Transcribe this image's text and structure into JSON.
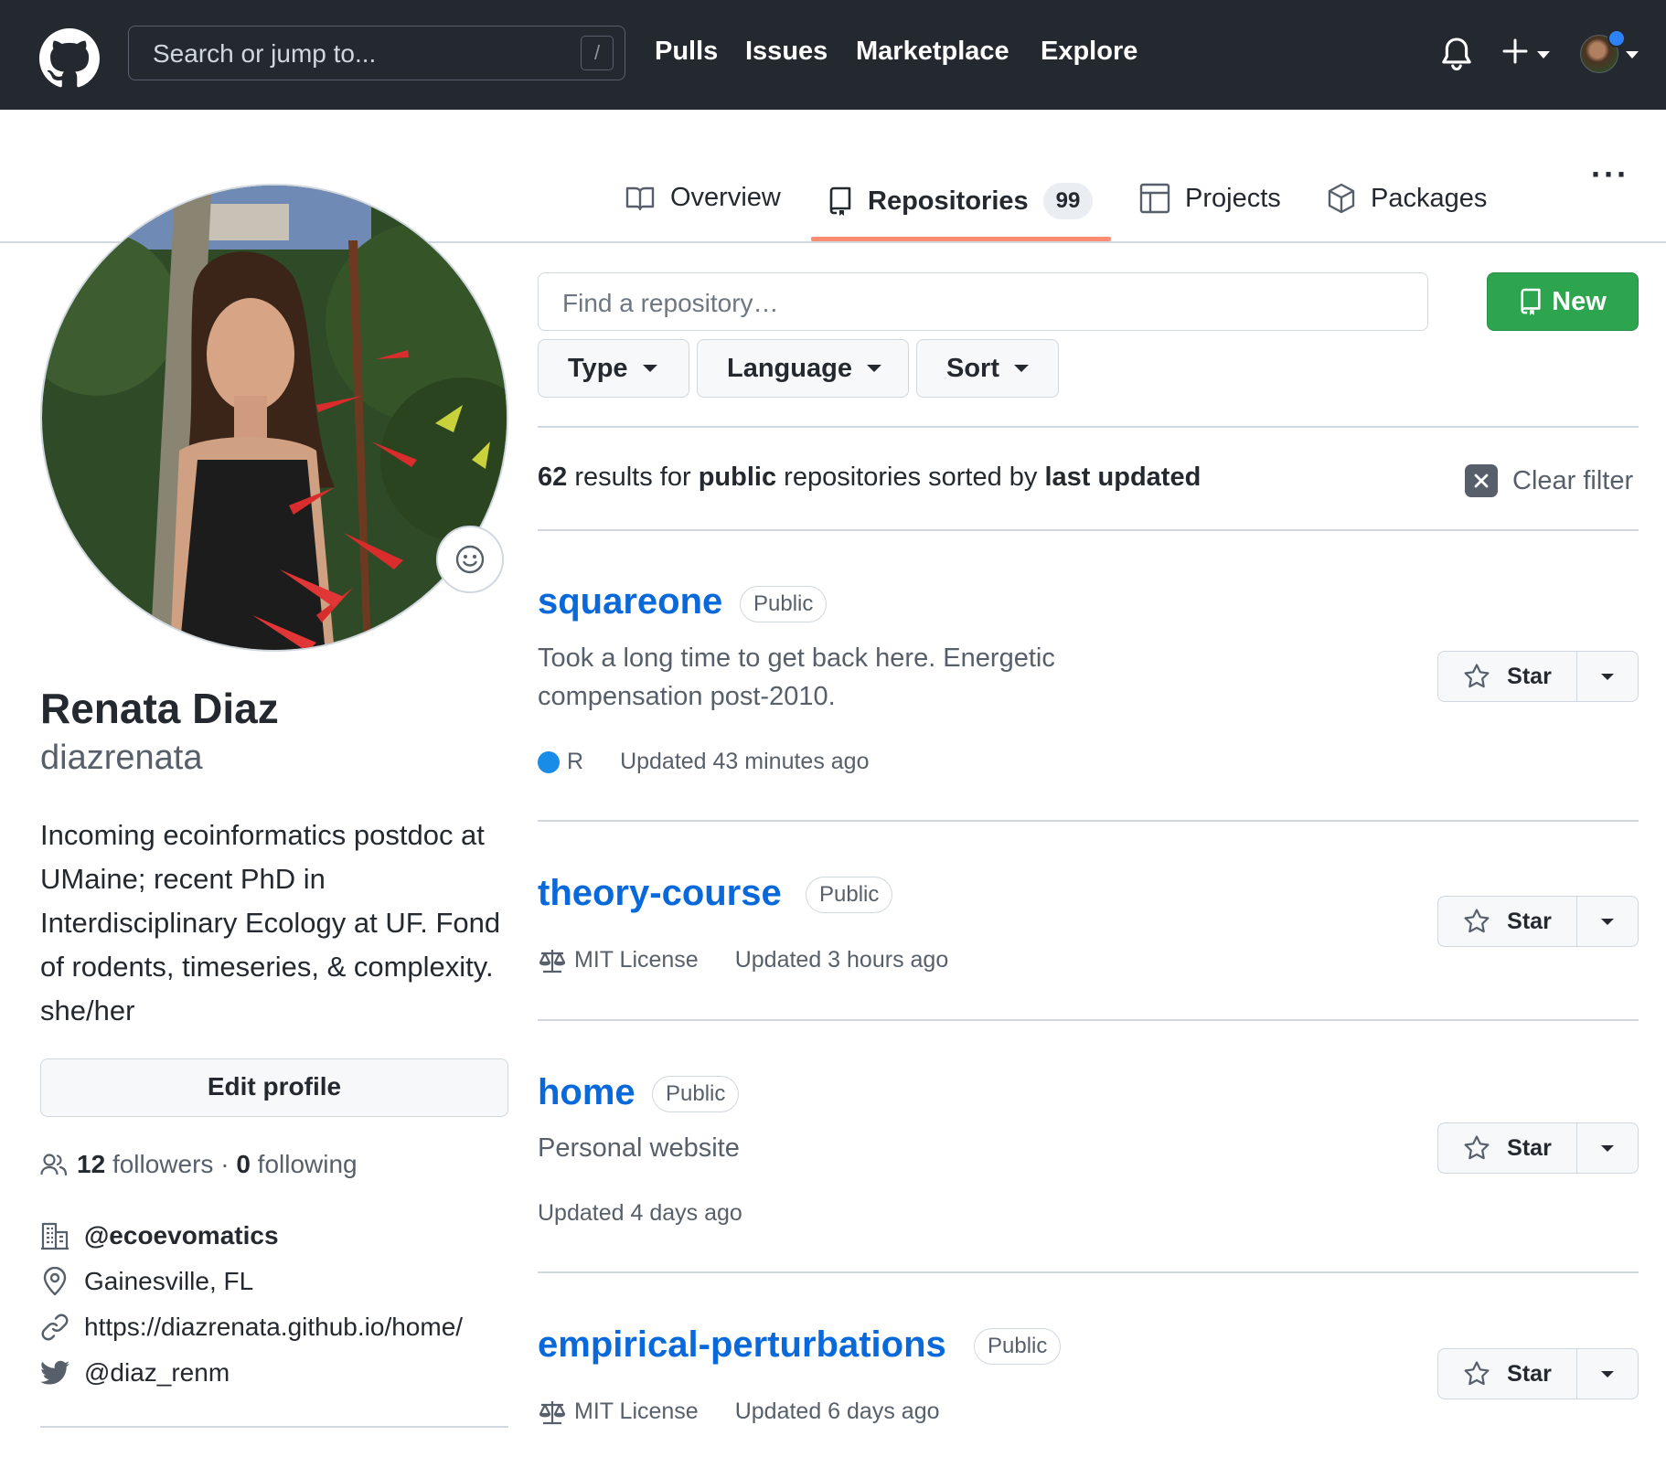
{
  "header": {
    "search_placeholder": "Search or jump to...",
    "search_shortcut": "/",
    "nav": [
      "Pulls",
      "Issues",
      "Marketplace",
      "Explore"
    ]
  },
  "tabs": [
    {
      "label": "Overview",
      "icon": "book-icon"
    },
    {
      "label": "Repositories",
      "icon": "repo-icon",
      "count": "99",
      "active": true
    },
    {
      "label": "Projects",
      "icon": "table-icon"
    },
    {
      "label": "Packages",
      "icon": "package-icon"
    }
  ],
  "profile": {
    "name": "Renata Diaz",
    "login": "diazrenata",
    "bio": "Incoming ecoinformatics postdoc at UMaine; recent PhD in Interdisciplinary Ecology at UF. Fond of rodents, timeseries, & complexity. she/her",
    "edit_label": "Edit profile",
    "followers_count": "12",
    "followers_label": "followers",
    "separator": "·",
    "following_count": "0",
    "following_label": "following",
    "organization": "@ecoevomatics",
    "location": "Gainesville, FL",
    "website": "https://diazrenata.github.io/home/",
    "twitter": "@diaz_renm"
  },
  "controls": {
    "find_placeholder": "Find a repository…",
    "new_label": "New",
    "filters": [
      "Type",
      "Language",
      "Sort"
    ]
  },
  "results": {
    "count": "62",
    "text1": "results for",
    "visibility": "public",
    "text2": "repositories sorted by",
    "sort": "last updated",
    "clear_label": "Clear filter"
  },
  "repos": [
    {
      "name": "squareone",
      "visibility": "Public",
      "description": "Took a long time to get back here. Energetic compensation post-2010.",
      "language": "R",
      "language_color": "#198ce7",
      "updated": "Updated 43 minutes ago",
      "star_label": "Star"
    },
    {
      "name": "theory-course",
      "visibility": "Public",
      "license": "MIT License",
      "updated": "Updated 3 hours ago",
      "star_label": "Star"
    },
    {
      "name": "home",
      "visibility": "Public",
      "description": "Personal website",
      "updated": "Updated 4 days ago",
      "star_label": "Star"
    },
    {
      "name": "empirical-perturbations",
      "visibility": "Public",
      "license": "MIT License",
      "updated": "Updated 6 days ago",
      "star_label": "Star"
    }
  ],
  "colors": {
    "header_bg": "#24292f",
    "link": "#0969da",
    "primary_button": "#2da44e",
    "tab_underline": "#fd8c73"
  }
}
